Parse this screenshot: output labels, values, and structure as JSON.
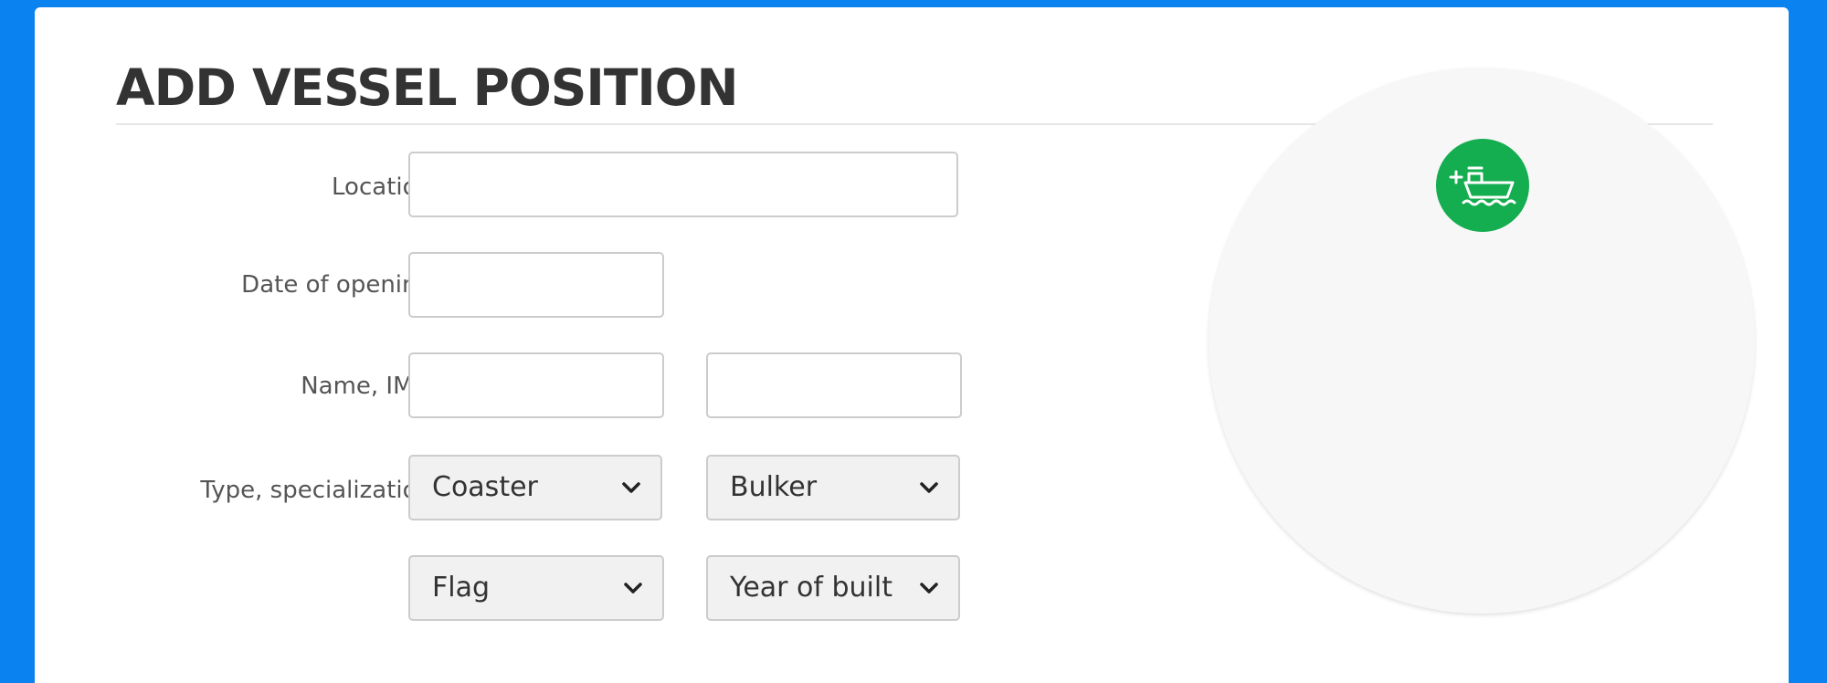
{
  "form": {
    "title": "ADD VESSEL POSITION",
    "labels": {
      "location": "Location",
      "date_of_opening": "Date of opening",
      "name_imo": "Name, IMO",
      "type_specialization": "Type, specialization"
    },
    "inputs": {
      "location": "",
      "date_of_opening": "",
      "name": "",
      "imo": ""
    },
    "selects": {
      "type": "Coaster",
      "specialization": "Bulker",
      "flag": "Flag",
      "year_of_built": "Year of built"
    }
  },
  "action": {
    "icon": "add-ship-icon"
  },
  "colors": {
    "background": "#0a82ef",
    "accent": "#14ad4f",
    "text": "#333333"
  }
}
